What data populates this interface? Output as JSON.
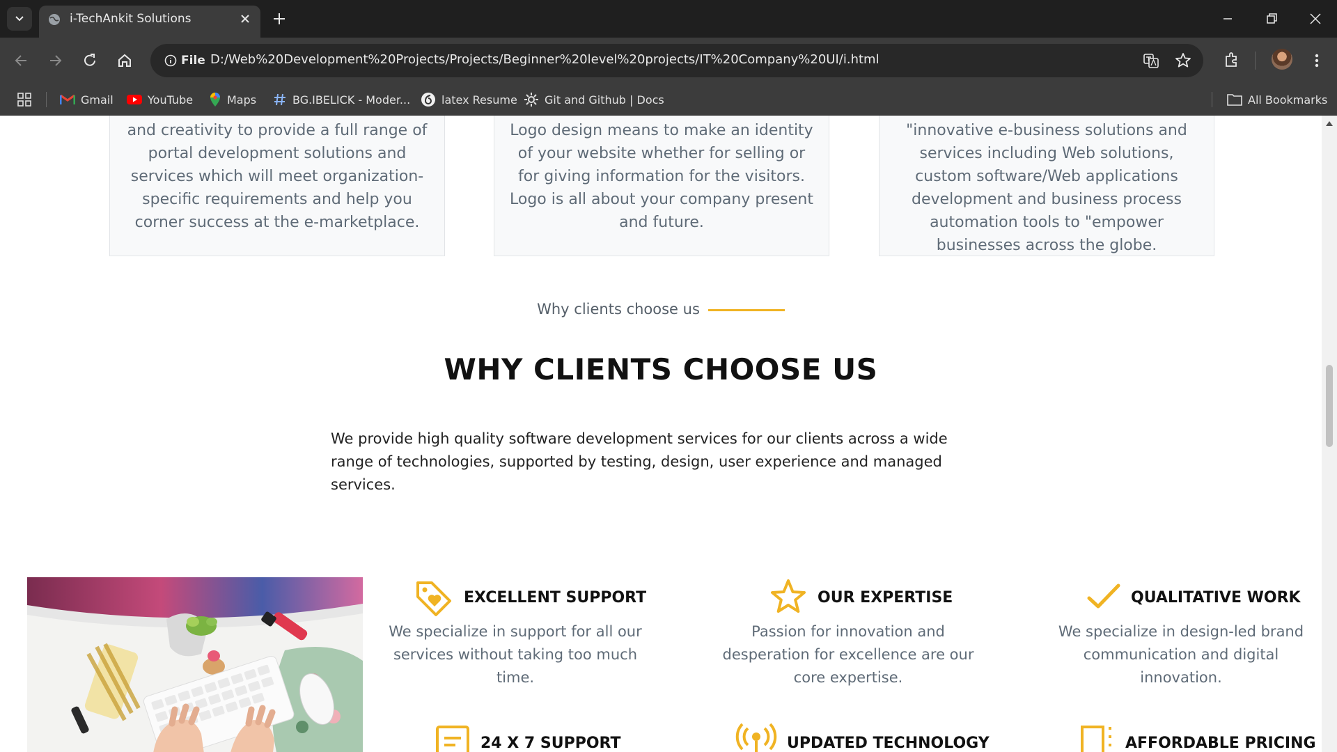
{
  "browser": {
    "tab_title": "i-TechAnkit Solutions",
    "omnibox_scheme": "File",
    "url": "D:/Web%20Development%20Projects/Projects/Beginner%20level%20projects/IT%20Company%20UI/i.html",
    "bookmarks": [
      {
        "label": "Gmail",
        "icon": "gmail-icon"
      },
      {
        "label": "YouTube",
        "icon": "youtube-icon"
      },
      {
        "label": "Maps",
        "icon": "maps-icon"
      },
      {
        "label": "BG.IBELICK - Moder...",
        "icon": "hash-icon"
      },
      {
        "label": "latex Resume",
        "icon": "latex-icon"
      },
      {
        "label": "Git and Github | Docs",
        "icon": "gear-icon"
      }
    ],
    "all_bookmarks": "All Bookmarks"
  },
  "cards": [
    {
      "text": "and creativity to provide a full range of portal development solutions and services which will meet organization-specific requirements and help you corner success at the e-marketplace."
    },
    {
      "text": "Logo design means to make an identity of your website whether for selling or for giving information for the visitors. Logo is all about your company present and future."
    },
    {
      "text": "\"innovative e-business solutions and services including Web solutions, custom software/Web applications development and business process automation tools to \"empower businesses across the globe."
    }
  ],
  "section": {
    "eyebrow": "Why clients choose us",
    "heading": "WHY CLIENTS CHOOSE US",
    "lead": "We provide high quality software development services for our clients across a wide range of technologies, supported by testing, design, user experience and managed services."
  },
  "features": [
    {
      "title": "EXCELLENT SUPPORT",
      "text": "We specialize in support for all our services without taking too much time.",
      "icon": "tag-heart-icon"
    },
    {
      "title": "OUR EXPERTISE",
      "text": "Passion for innovation and desperation for excellence are our core expertise.",
      "icon": "star-icon"
    },
    {
      "title": "QUALITATIVE WORK",
      "text": "We specialize in design-led brand communication and digital innovation.",
      "icon": "check-icon"
    },
    {
      "title": "24 X 7 SUPPORT",
      "text": "",
      "icon": "document-icon"
    },
    {
      "title": "UPDATED TECHNOLOGY",
      "text": "",
      "icon": "broadcast-icon"
    },
    {
      "title": "AFFORDABLE PRICING",
      "text": "",
      "icon": "pricing-icon"
    }
  ],
  "colors": {
    "accent": "#f0b323",
    "chrome_dark": "#1f1f1f",
    "chrome_mid": "#3c3c3c"
  }
}
